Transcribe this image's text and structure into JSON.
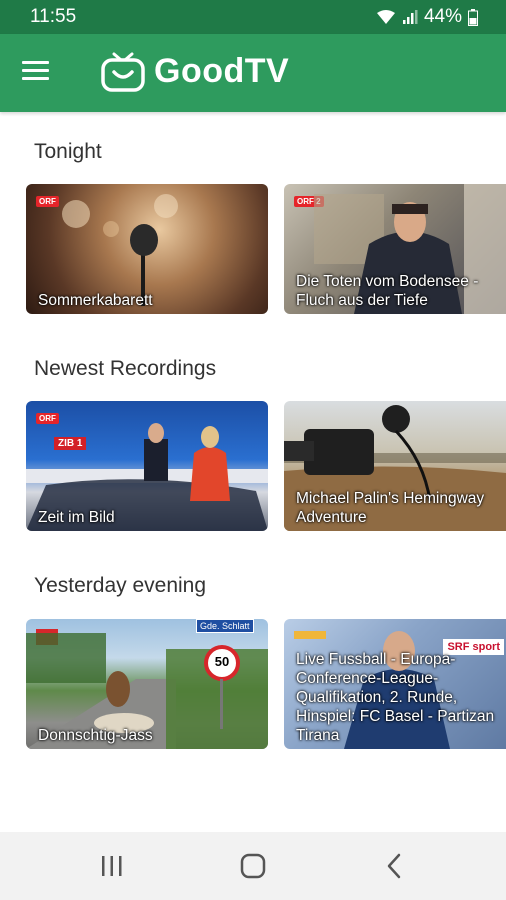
{
  "status": {
    "time": "11:55",
    "battery": "44%"
  },
  "app": {
    "title": "GoodTV"
  },
  "sections": [
    {
      "title": "Tonight",
      "cards": [
        {
          "label": "Sommerkabarett",
          "channel": "ORF"
        },
        {
          "label": "Die Toten vom Bodensee - Fluch aus der Tiefe",
          "channel": "ORF 2"
        }
      ]
    },
    {
      "title": "Newest Recordings",
      "cards": [
        {
          "label": "Zeit im Bild",
          "channel": "ORF"
        },
        {
          "label": "Michael Palin's Hemingway Adventure",
          "channel": ""
        }
      ]
    },
    {
      "title": "Yesterday evening",
      "cards": [
        {
          "label": "Donnschtig-Jass",
          "channel": ""
        },
        {
          "label": "Live Fussball - Europa-Conference-League-Qualifikation, 2. Runde, Hinspiel: FC Basel - Partizan Tirana",
          "channel": ""
        }
      ]
    }
  ],
  "card_extras": {
    "road_sign": "Gde. Schlatt",
    "speed_limit": "50",
    "srf_badge": "SRF sport",
    "zib_badge": "ZIB 1"
  },
  "colors": {
    "status_bar": "#1f7a47",
    "app_bar": "#2e9b5e"
  },
  "icons": {
    "menu": "hamburger-icon",
    "logo": "tv-smile-icon",
    "wifi": "wifi-icon",
    "signal": "signal-icon",
    "battery": "battery-icon",
    "recents": "recents-icon",
    "home": "home-icon",
    "back": "back-icon"
  }
}
